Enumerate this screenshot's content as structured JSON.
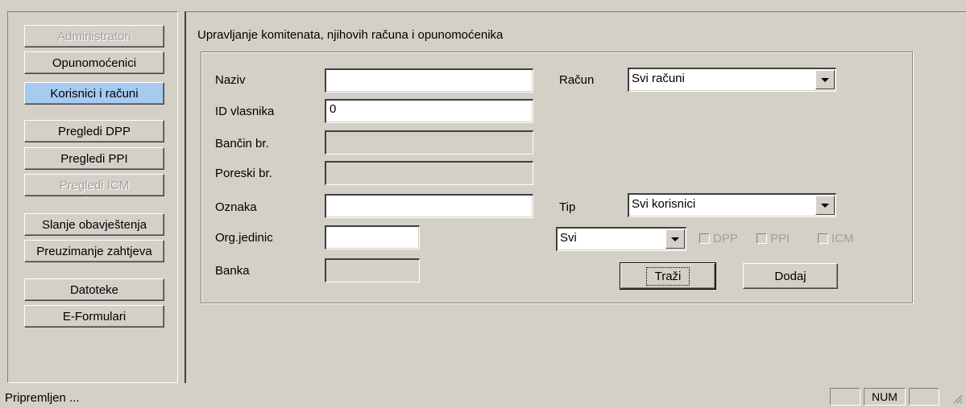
{
  "nav": {
    "items": [
      {
        "label": "Administratori",
        "state": "disabled"
      },
      {
        "label": "Opunomoćenici",
        "state": "normal"
      },
      {
        "label": "Korisnici i računi",
        "state": "selected"
      },
      {
        "label": "Pregledi DPP",
        "state": "normal"
      },
      {
        "label": "Pregledi PPI",
        "state": "normal"
      },
      {
        "label": "Pregledi ICM",
        "state": "disabled"
      },
      {
        "label": "Slanje obavještenja",
        "state": "normal"
      },
      {
        "label": "Preuzimanje zahtjeva",
        "state": "normal"
      },
      {
        "label": "Datoteke",
        "state": "normal"
      },
      {
        "label": "E-Formulari",
        "state": "normal"
      }
    ]
  },
  "main": {
    "title": "Upravljanje komitenata, njihovih računa i opunomoćenika",
    "form": {
      "naziv_label": "Naziv",
      "naziv_value": "",
      "id_label": "ID vlasnika",
      "id_value": "0",
      "bancin_label": "Bančin br.",
      "bancin_value": "",
      "poreski_label": "Poreski br.",
      "poreski_value": "",
      "oznaka_label": "Oznaka",
      "oznaka_value": "",
      "orgjed_label": "Org.jedinic",
      "orgjed_value": "",
      "banka_label": "Banka",
      "banka_value": "",
      "racun_label": "Račun",
      "racun_value": "Svi računi",
      "tip_label": "Tip",
      "tip_value": "Svi korisnici",
      "filter_value": "Svi",
      "chk_dpp": "DPP",
      "chk_ppi": "PPI",
      "chk_icm": "ICM",
      "search_label": "Traži",
      "add_label": "Dodaj"
    }
  },
  "status": {
    "text": "Pripremljen ...",
    "num": "NUM"
  },
  "colors": {
    "face": "#d4d0c8",
    "selected": "#a6caf0",
    "disabled_text": "#a0a0a0"
  }
}
